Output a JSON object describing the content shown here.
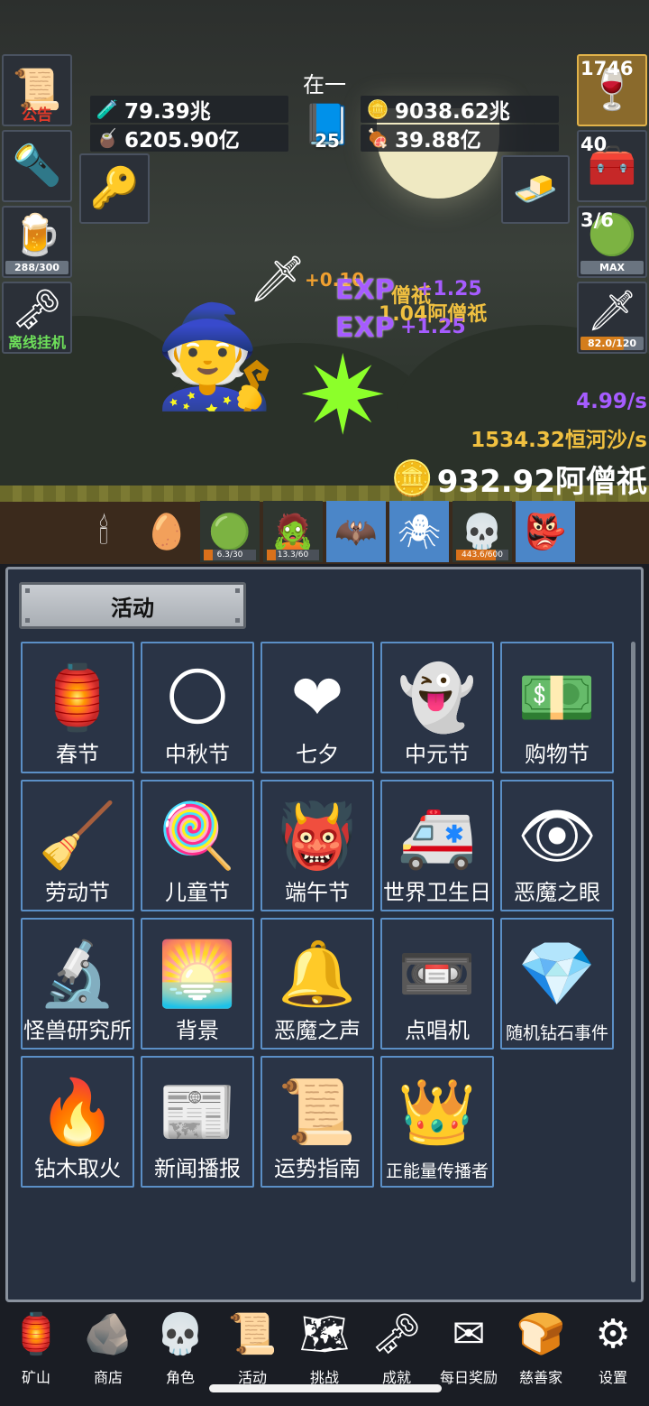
{
  "header": {
    "title": "在一",
    "level_badge": "25"
  },
  "left_buttons": [
    {
      "label": "公告",
      "icon": "scroll-icon"
    },
    {
      "label": "",
      "icon": "torch-icon"
    },
    {
      "label": "288/300",
      "icon": "beer-mug-icon",
      "progress": 0.96
    },
    {
      "label": "离线挂机",
      "icon": "key-icon"
    }
  ],
  "right_buttons": [
    {
      "value": "1746",
      "icon": "potion-icon"
    },
    {
      "value": "40",
      "icon": "treasure-chest-icon"
    },
    {
      "value": "3/6",
      "cap": "MAX",
      "icon": "slime-icon"
    },
    {
      "value": "82.0/120",
      "icon": "sword-icon",
      "progress": 0.68
    }
  ],
  "resources": {
    "blue_potion": "79.39兆",
    "green_potion": "6205.90亿",
    "coin": "9038.62兆",
    "meat": "39.88亿"
  },
  "combat": {
    "exp1": "EXP",
    "exp2": "EXP",
    "float1": "+0.10",
    "float2": "僧祇",
    "float3": "+1.25",
    "float4": "1.04阿僧祇",
    "float5": "+1.25",
    "rate_per_sec": "4.99/s",
    "gold_rate": "1534.32恒河沙/s",
    "gold_total": "932.92阿僧祇"
  },
  "monsters": [
    {
      "icon": "candle-icon"
    },
    {
      "icon": "egg-icon"
    },
    {
      "icon": "slime-icon",
      "level": "6.3/30",
      "progress": 0.21
    },
    {
      "icon": "zombie-icon",
      "level": "13.3/60",
      "progress": 0.22
    },
    {
      "icon": "bat-icon"
    },
    {
      "icon": "spider-icon"
    },
    {
      "icon": "reaper-icon",
      "level": "443.6/600",
      "progress": 0.74
    },
    {
      "icon": "orc-icon"
    }
  ],
  "panel": {
    "tab_label": "活动",
    "tiles": [
      {
        "label": "春节",
        "icon": "lantern-icon",
        "glyph": "🏮"
      },
      {
        "label": "中秋节",
        "icon": "moon-icon",
        "glyph": "🌕"
      },
      {
        "label": "七夕",
        "icon": "heart-icon",
        "glyph": "❤"
      },
      {
        "label": "中元节",
        "icon": "ghost-icon",
        "glyph": "👻"
      },
      {
        "label": "购物节",
        "icon": "money-icon",
        "glyph": "💵"
      },
      {
        "label": "劳动节",
        "icon": "brush-icon",
        "glyph": "🧹"
      },
      {
        "label": "儿童节",
        "icon": "lollipop-icon",
        "glyph": "🍭"
      },
      {
        "label": "端午节",
        "icon": "dragon-mask-icon",
        "glyph": "👹"
      },
      {
        "label": "世界卫生日",
        "icon": "ambulance-icon",
        "glyph": "🚑"
      },
      {
        "label": "恶魔之眼",
        "icon": "eye-icon",
        "glyph": "👁"
      },
      {
        "label": "怪兽研究所",
        "icon": "research-icon",
        "glyph": "🔬"
      },
      {
        "label": "背景",
        "icon": "sunset-icon",
        "glyph": "🌅"
      },
      {
        "label": "恶魔之声",
        "icon": "bell-icon",
        "glyph": "🔔"
      },
      {
        "label": "点唱机",
        "icon": "cassette-icon",
        "glyph": "📼"
      },
      {
        "label": "随机钻石事件",
        "icon": "diamond-icon",
        "glyph": "💎"
      },
      {
        "label": "钻木取火",
        "icon": "fire-stick-icon",
        "glyph": "🔥"
      },
      {
        "label": "新闻播报",
        "icon": "newspaper-icon",
        "glyph": "📰"
      },
      {
        "label": "运势指南",
        "icon": "fortune-icon",
        "glyph": "📜"
      },
      {
        "label": "正能量传播者",
        "icon": "crown-icon",
        "glyph": "👑"
      }
    ]
  },
  "nav": [
    {
      "label": "矿山",
      "icon": "lantern-icon",
      "glyph": "🏮"
    },
    {
      "label": "商店",
      "icon": "shop-icon",
      "glyph": "🪨"
    },
    {
      "label": "角色",
      "icon": "skull-icon",
      "glyph": "💀"
    },
    {
      "label": "活动",
      "icon": "scroll-icon",
      "glyph": "📜"
    },
    {
      "label": "挑战",
      "icon": "map-icon",
      "glyph": "🗺"
    },
    {
      "label": "成就",
      "icon": "key-icon",
      "glyph": "🗝"
    },
    {
      "label": "每日奖励",
      "icon": "envelope-icon",
      "glyph": "✉"
    },
    {
      "label": "慈善家",
      "icon": "bread-icon",
      "glyph": "🍞"
    },
    {
      "label": "设置",
      "icon": "gear-icon",
      "glyph": "⚙"
    }
  ],
  "colors": {
    "panel_bg": "#273040",
    "tile_border": "#5b8fc6",
    "gold_text": "#f0c040",
    "exp_purple": "#a65cff"
  }
}
